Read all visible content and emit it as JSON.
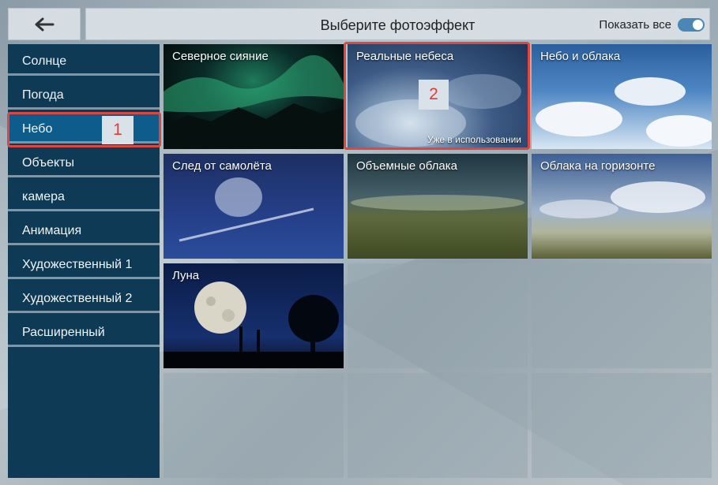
{
  "header": {
    "back_icon": "arrow-left-icon",
    "title": "Выберите фотоэффект",
    "show_all_label": "Показать все",
    "show_all_enabled": true
  },
  "sidebar": {
    "items": [
      {
        "label": "Солнце",
        "active": false
      },
      {
        "label": "Погода",
        "active": false
      },
      {
        "label": "Небо",
        "active": true
      },
      {
        "label": "Объекты",
        "active": false
      },
      {
        "label": "камера",
        "active": false
      },
      {
        "label": "Анимация",
        "active": false
      },
      {
        "label": "Художественный 1",
        "active": false
      },
      {
        "label": "Художественный 2",
        "active": false
      },
      {
        "label": "Расширенный",
        "active": false
      }
    ]
  },
  "effects": [
    {
      "label": "Северное сияние"
    },
    {
      "label": "Реальные небеса",
      "badge": "Уже в использовании"
    },
    {
      "label": "Небо и облака"
    },
    {
      "label": "След от самолёта"
    },
    {
      "label": "Объемные облака"
    },
    {
      "label": "Облака на горизонте"
    },
    {
      "label": "Луна"
    }
  ],
  "callouts": {
    "one": "1",
    "two": "2"
  },
  "colors": {
    "sidebar_bg": "#0e3a55",
    "sidebar_active": "#0d5c8c",
    "highlight": "#e0463e",
    "toggle": "#4a87b5"
  }
}
